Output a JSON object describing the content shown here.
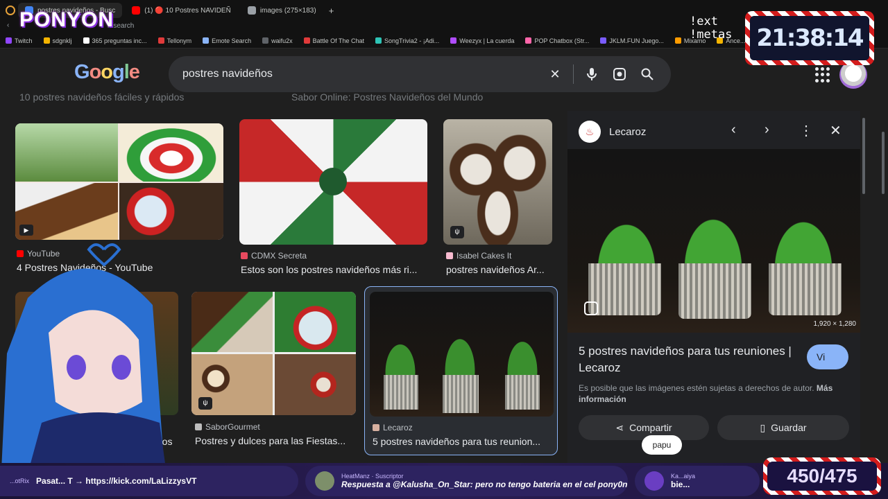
{
  "tabs": [
    {
      "label": "postres navideños - Busc",
      "color": "#4285f4",
      "active": true
    },
    {
      "label": "(1) 🔴 10 Postres NAVIDEÑ",
      "color": "#ff0000",
      "active": false
    },
    {
      "label": "images (275×183)",
      "color": "#9aa0a6",
      "active": false
    }
  ],
  "url_fragment": "n/search",
  "bookmarks": [
    {
      "label": "Twitch",
      "color": "#9146ff"
    },
    {
      "label": "sdgnklj",
      "color": "#f4b400"
    },
    {
      "label": "365 preguntas inc...",
      "color": "#ffffff"
    },
    {
      "label": "Tellonym",
      "color": "#e03a3a"
    },
    {
      "label": "Emote Search",
      "color": "#8ab4f8"
    },
    {
      "label": "waifu2x",
      "color": "#5f6368"
    },
    {
      "label": "Battle Of The Chat",
      "color": "#e03a3a"
    },
    {
      "label": "SongTrivia2 - ¡Adi...",
      "color": "#2ec4b6"
    },
    {
      "label": "Weezyx | La cuerda",
      "color": "#b04cff"
    },
    {
      "label": "POP Chatbox (Str...",
      "color": "#ff66aa"
    },
    {
      "label": "JKLM.FUN Juego...",
      "color": "#7a5cff"
    },
    {
      "label": "Mixamo",
      "color": "#ff9c00"
    },
    {
      "label": "Ance...",
      "color": "#f4b400"
    }
  ],
  "google": {
    "logo": "Google",
    "query": "postres navideños",
    "faded_titles": [
      "10 postres navideños fáciles y rápidos",
      "Sabor Online: Postres Navideños del Mundo"
    ]
  },
  "results": [
    {
      "source": "YouTube",
      "title": "4 Postres Navideños - YouTube",
      "fav": "#ff0000"
    },
    {
      "source": "CDMX Secreta",
      "title": "Estos son los postres navideños más ri...",
      "fav": "#e84a5f"
    },
    {
      "source": "Isabel Cakes It",
      "title": "postres navideños Ar...",
      "fav": "#f8bbd0"
    },
    {
      "source": "",
      "title": "...os",
      "fav": "#888888"
    },
    {
      "source": "SaborGourmet",
      "title": "Postres y dulces para las Fiestas...",
      "fav": "#bdbdbd"
    },
    {
      "source": "Lecaroz",
      "title": "5 postres navideños para tus reunion...",
      "fav": "#d7b0a0"
    }
  ],
  "panel": {
    "site": "Lecaroz",
    "dimensions": "1,920 × 1,280",
    "title": "5 postres navideños para tus reuniones | Lecaroz",
    "note": "Es posible que las imágenes estén sujetas a derechos de autor.",
    "more": "Más información",
    "share": "Compartir",
    "save": "Guardar",
    "visit": "Vi"
  },
  "overlay": {
    "brand": "PONYON",
    "commands": "!ext\n!metas",
    "clock": "21:38:14",
    "counter": "450/475",
    "papu": "papu"
  },
  "chat": [
    {
      "user": "...otRix",
      "text": "Pasat... T → https://kick.com/LaLizzysVT"
    },
    {
      "user": "HeatManz",
      "badge": "Suscriptor",
      "text": "Respuesta a @Kalusha_On_Star: pero no tengo bateria en el cel pony0nWaa: ps..."
    },
    {
      "user": "Ka...aiya",
      "text": "bie..."
    }
  ]
}
